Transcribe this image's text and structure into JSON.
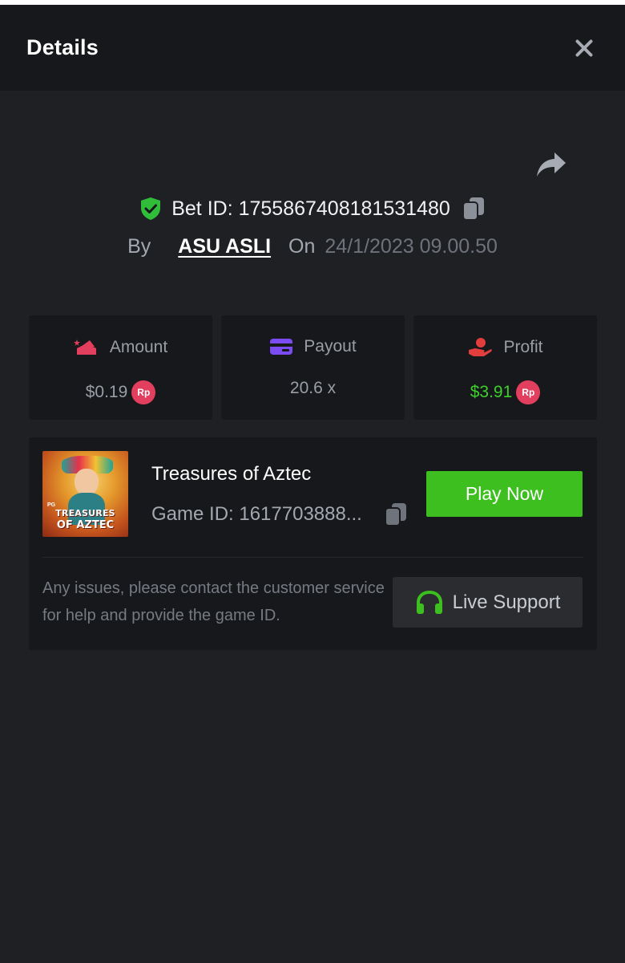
{
  "header": {
    "title": "Details",
    "close_icon": "close-icon"
  },
  "share_icon": "share-icon",
  "bet": {
    "id_label": "Bet ID: 1755867408181531480",
    "verified_icon": "shield-check-icon",
    "copy_icon": "copy-icon",
    "by_label": "By",
    "username": "ASU ASLI",
    "on_label": "On",
    "datetime": "24/1/2023 09.00.50"
  },
  "stats": [
    {
      "label": "Amount",
      "value": "$0.19",
      "currency_badge": "Rp",
      "icon": "amount-icon",
      "icon_color": "#e23e5d"
    },
    {
      "label": "Payout",
      "value": "20.6 x",
      "icon": "payout-card-icon",
      "icon_color": "#7b4cf2"
    },
    {
      "label": "Profit",
      "value": "$3.91",
      "currency_badge": "Rp",
      "icon": "profit-hand-icon",
      "icon_color": "#e23e3e",
      "value_color": "#3dd02a"
    }
  ],
  "game": {
    "thumbnail_logo": "PG",
    "thumbnail_line1": "TREASURES",
    "thumbnail_line2": "OF AZTEC",
    "title": "Treasures of Aztec",
    "id_label": "Game ID: 1617703888...",
    "play_button": "Play Now"
  },
  "support": {
    "help_text": "Any issues, please contact the customer service for help and provide the game ID.",
    "button_label": "Live Support",
    "icon": "headset-icon"
  },
  "colors": {
    "background": "#1f2024",
    "panel": "#17181b",
    "accent_green": "#3cbf1f",
    "badge_red": "#e23e5d"
  }
}
